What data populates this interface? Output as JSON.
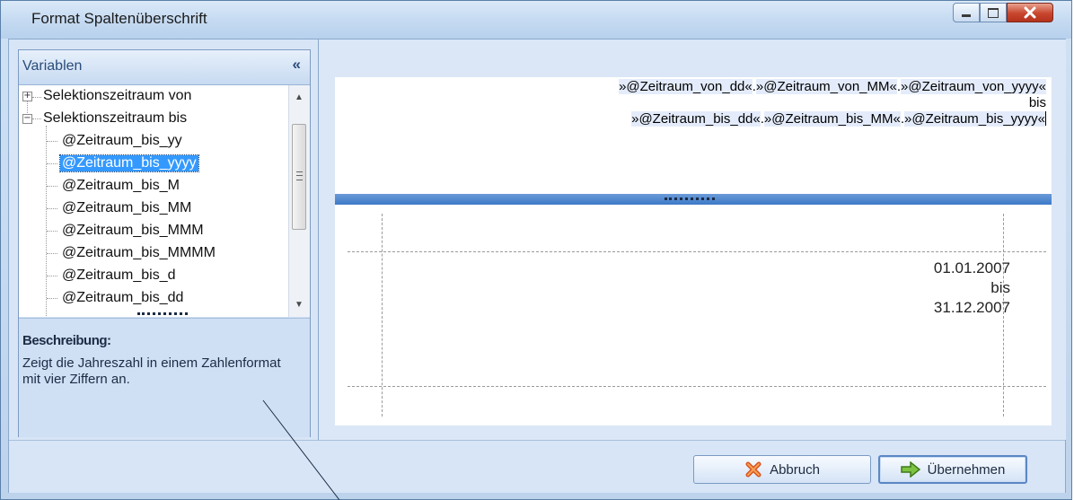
{
  "window": {
    "title": "Format Spaltenüberschrift"
  },
  "variables_panel": {
    "title": "Variablen",
    "collapse_glyph": "«",
    "tree": [
      {
        "label": "Selektionszeitraum von",
        "expander": "+",
        "level": 0
      },
      {
        "label": "Selektionszeitraum bis",
        "expander": "−",
        "level": 0
      },
      {
        "label": "@Zeitraum_bis_yy",
        "level": 1
      },
      {
        "label": "@Zeitraum_bis_yyyy",
        "level": 1,
        "selected": true
      },
      {
        "label": "@Zeitraum_bis_M",
        "level": 1
      },
      {
        "label": "@Zeitraum_bis_MM",
        "level": 1
      },
      {
        "label": "@Zeitraum_bis_MMM",
        "level": 1
      },
      {
        "label": "@Zeitraum_bis_MMMM",
        "level": 1
      },
      {
        "label": "@Zeitraum_bis_d",
        "level": 1
      },
      {
        "label": "@Zeitraum_bis_dd",
        "level": 1
      }
    ]
  },
  "description": {
    "title": "Beschreibung:",
    "text": "Zeigt die Jahreszahl in einem Zahlenformat mit vier Ziffern an."
  },
  "editor": {
    "line1": [
      "»@Zeitraum_von_dd«",
      ".",
      "»@Zeitraum_von_MM«",
      ".",
      "»@Zeitraum_von_yyyy«"
    ],
    "line2": "bis",
    "line3": [
      "»@Zeitraum_bis_dd«",
      ".",
      "»@Zeitraum_bis_MM«",
      ".",
      "»@Zeitraum_bis_yyyy«"
    ]
  },
  "preview": {
    "line1": "01.01.2007",
    "line2": "bis",
    "line3": "31.12.2007"
  },
  "buttons": {
    "cancel": "Abbruch",
    "apply": "Übernehmen"
  },
  "colors": {
    "accent": "#3c79c8",
    "selection": "#3399ff",
    "close_button": "#c8452e"
  }
}
